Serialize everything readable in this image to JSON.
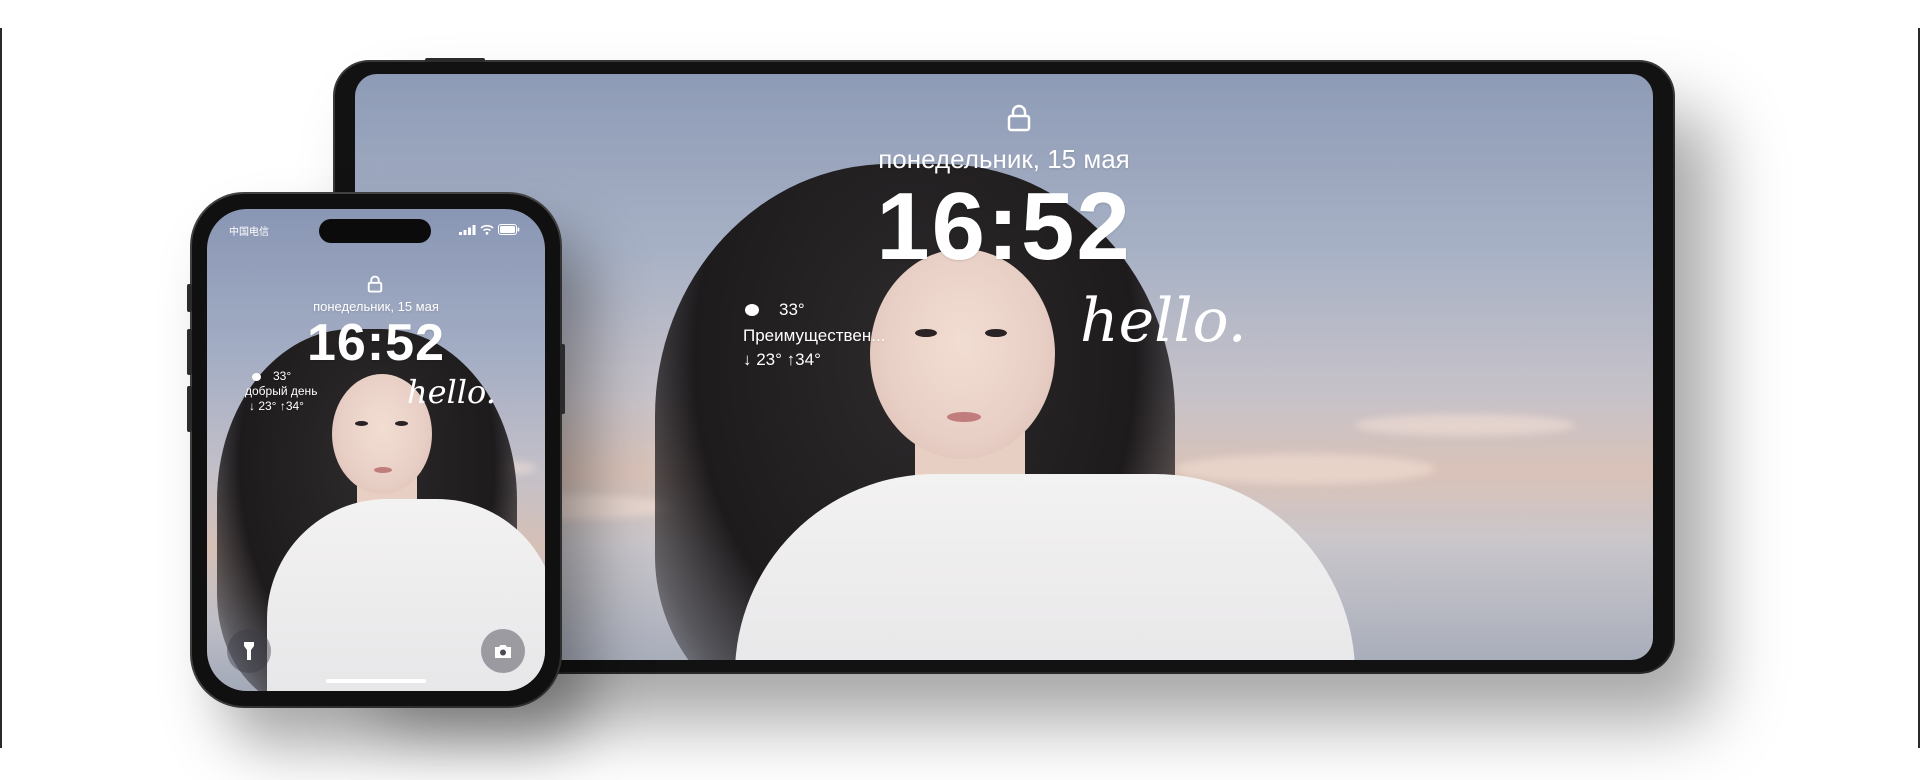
{
  "tablet": {
    "date": "понедельник, 15 мая",
    "time": "16:52",
    "temp": "33°",
    "condition": "Преимуществен...",
    "range": "↓ 23° ↑34°",
    "hello": "hello."
  },
  "phone": {
    "carrier": "中国电信",
    "date": "понедельник, 15 мая",
    "time": "16:52",
    "temp": "33°",
    "condition": "добрый день",
    "range": "↓ 23° ↑34°",
    "hello": "hello."
  },
  "icons": {
    "lock": "lock-icon",
    "flashlight": "flashlight-icon",
    "camera": "camera-icon",
    "signal": "signal-icon",
    "wifi": "wifi-icon",
    "battery": "battery-icon",
    "weather": "weather-icon"
  },
  "colors": {
    "frame": "#121212",
    "sky_top": "#8e9bb6",
    "sky_warm": "#d9c2b8",
    "text": "#ffffff"
  }
}
